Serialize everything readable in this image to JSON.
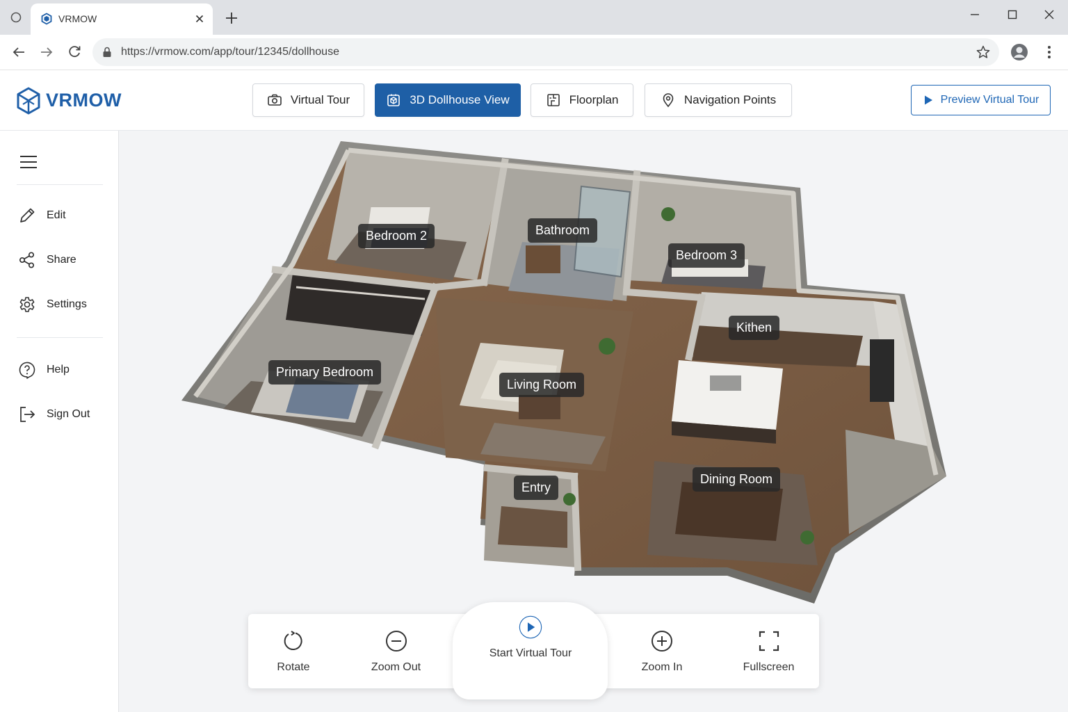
{
  "browser": {
    "tab_title": "VRMOW",
    "url": "https://vrmow.com/app/tour/12345/dollhouse",
    "icons": [
      "tab-circle-icon",
      "vrmow-favicon-icon",
      "close-icon",
      "plus-icon",
      "minimize-icon",
      "maximize-icon",
      "window-close-icon",
      "back-arrow-icon",
      "forward-arrow-icon",
      "reload-icon",
      "lock-icon",
      "star-icon",
      "profile-icon",
      "kebab-menu-icon"
    ]
  },
  "header": {
    "logo_text": "VRMOW",
    "tabs": [
      {
        "label": "Virtual Tour",
        "icon": "camera-icon",
        "active": false
      },
      {
        "label": "3D Dollhouse View",
        "icon": "cube-icon",
        "active": true
      },
      {
        "label": "Floorplan",
        "icon": "floorplan-icon",
        "active": false
      },
      {
        "label": "Navigation Points",
        "icon": "map-pin-icon",
        "active": false
      }
    ],
    "preview_label": "Preview Virtual Tour"
  },
  "sidebar": {
    "items": [
      {
        "label": "Edit",
        "icon": "pencil-icon"
      },
      {
        "label": "Share",
        "icon": "share-icon"
      },
      {
        "label": "Settings",
        "icon": "gear-icon"
      },
      {
        "label": "Help",
        "icon": "help-icon"
      },
      {
        "label": "Sign Out",
        "icon": "sign-out-icon"
      }
    ]
  },
  "rooms": [
    "Bedroom 2",
    "Bathroom",
    "Bedroom 3",
    "Kithen",
    "Primary Bedroom",
    "Living Room",
    "Entry",
    "Dining Room"
  ],
  "controls": {
    "rotate": "Rotate",
    "zoom_out": "Zoom Out",
    "start": "Start Virtual Tour",
    "zoom_in": "Zoom In",
    "fullscreen": "Fullscreen"
  },
  "colors": {
    "brand": "#1f5fa8",
    "active_tab": "#1e5fa6",
    "accent": "#1e66b5"
  }
}
